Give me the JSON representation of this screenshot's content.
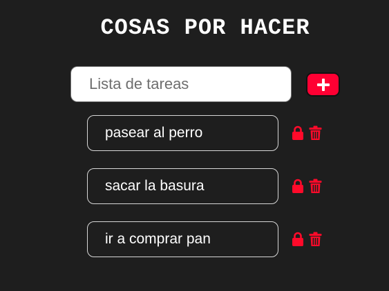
{
  "header": {
    "title": "COSAS POR HACER"
  },
  "new_task": {
    "placeholder": "Lista de tareas",
    "value": ""
  },
  "add_button": {
    "symbol": "+"
  },
  "tasks": [
    {
      "text": "pasear al perro"
    },
    {
      "text": "sacar la basura"
    },
    {
      "text": "ir a comprar pan"
    }
  ],
  "icons": {
    "lock": "lock-icon",
    "delete": "trash-icon"
  },
  "colors": {
    "background": "#1e1e1e",
    "accent": "#ff0033",
    "text": "#ffffff"
  }
}
